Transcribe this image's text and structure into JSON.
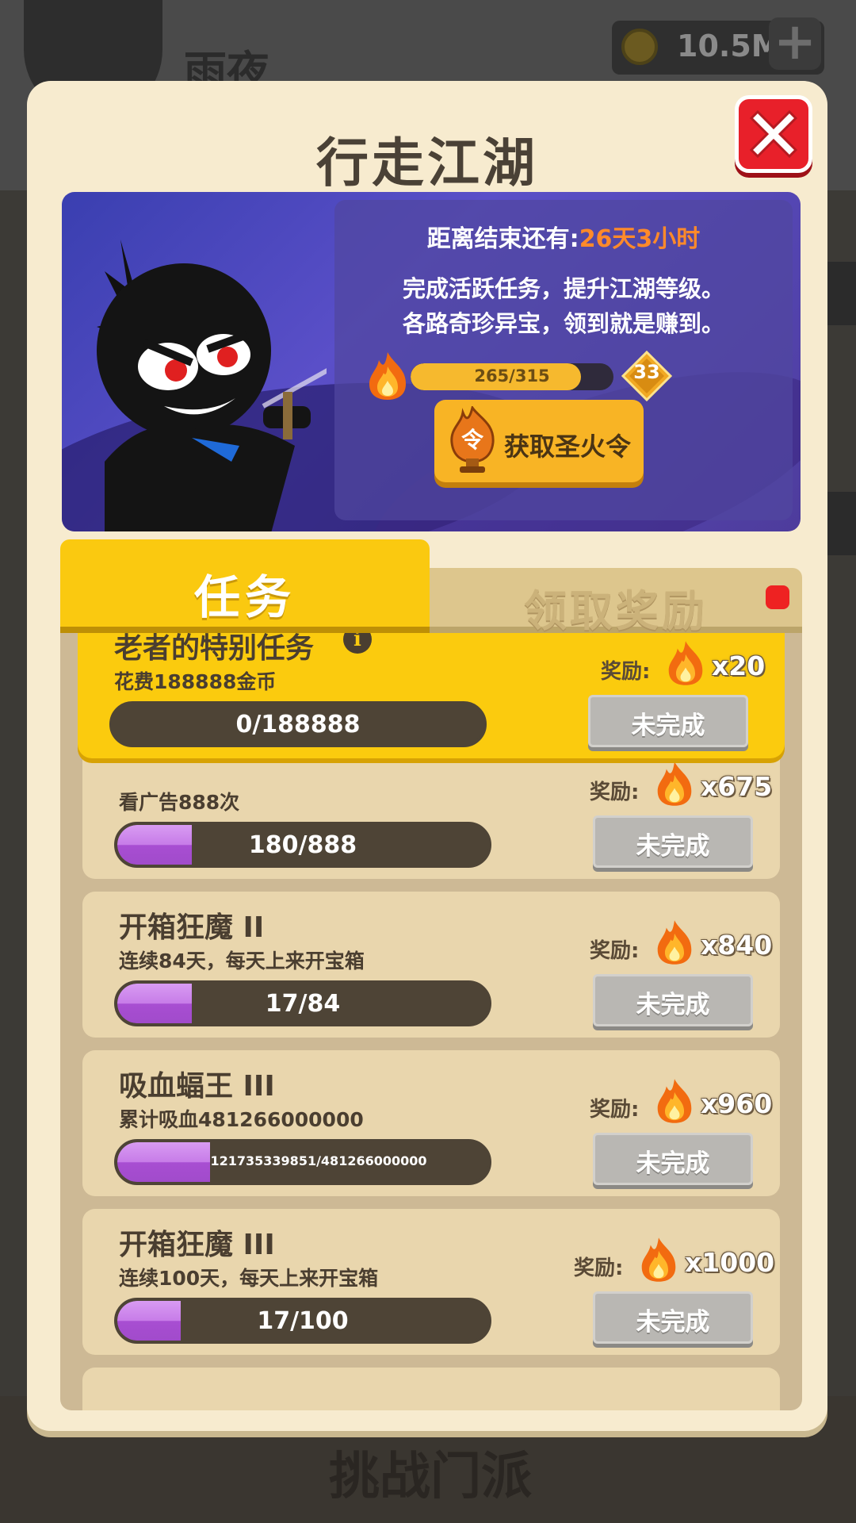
{
  "background": {
    "player_name": "雨夜",
    "coins": "10.5M",
    "bottom_challenge": "挑战门派"
  },
  "modal": {
    "title": "行走江湖",
    "banner": {
      "countdown_prefix": "距离结束还有:",
      "countdown_value": "26天3小时",
      "desc_line1": "完成活跃任务，提升江湖等级。",
      "desc_line2": "各路奇珍异宝，领到就是赚到。",
      "progress_text": "265/315",
      "progress": 0.841,
      "level": "33",
      "get_button_label": "获取圣火令",
      "get_button_icon_char": "令"
    },
    "tabs": {
      "tasks": "任务",
      "rewards": "领取奖励"
    },
    "reward_label": "奖励:",
    "tasks": [
      {
        "title": "老者的特别任务",
        "desc": "花费188888金币",
        "progress_text": "0/188888",
        "progress": 0.0,
        "reward": "x20",
        "status": "未完成",
        "special": true
      },
      {
        "title": "",
        "desc": "看广告888次",
        "progress_text": "180/888",
        "progress": 0.203,
        "reward": "x675",
        "status": "未完成"
      },
      {
        "title": "开箱狂魔 II",
        "desc": "连续84天，每天上来开宝箱",
        "progress_text": "17/84",
        "progress": 0.202,
        "reward": "x840",
        "status": "未完成"
      },
      {
        "title": "吸血蝠王 III",
        "desc": "累计吸血481266000000",
        "progress_text": "121735339851/481266000000",
        "progress": 0.253,
        "reward": "x960",
        "status": "未完成"
      },
      {
        "title": "开箱狂魔 III",
        "desc": "连续100天，每天上来开宝箱",
        "progress_text": "17/100",
        "progress": 0.17,
        "reward": "x1000",
        "status": "未完成"
      }
    ]
  },
  "colors": {
    "accent_yellow": "#fac910",
    "orange_highlight": "#ff8a2a",
    "close_red": "#e8202a",
    "progress_purple": "#c77ce8"
  }
}
